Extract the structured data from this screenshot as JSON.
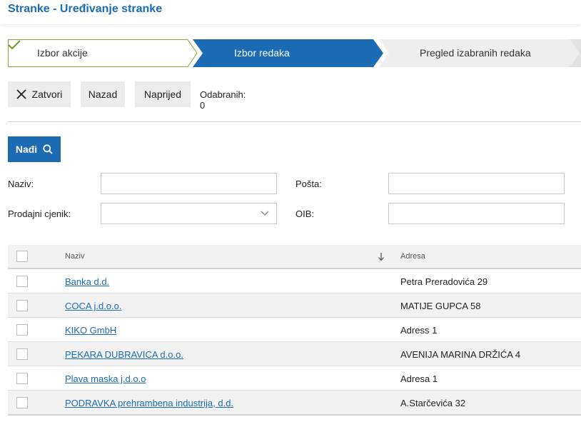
{
  "page": {
    "title": "Stranke - Uređivanje stranke"
  },
  "wizard": {
    "steps": [
      {
        "label": "Izbor akcije",
        "state": "done"
      },
      {
        "label": "Izbor redaka",
        "state": "active"
      },
      {
        "label": "Pregled izabranih redaka",
        "state": "pending"
      }
    ]
  },
  "toolbar": {
    "close_label": "Zatvori",
    "back_label": "Nazad",
    "next_label": "Naprijed",
    "selected_text": "Odabranih: 0"
  },
  "search": {
    "find_label": "Nađi",
    "fields": {
      "naziv": {
        "label": "Naziv:",
        "value": ""
      },
      "posta": {
        "label": "Pošta:",
        "value": ""
      },
      "cjenik": {
        "label": "Prodajni cjenik:",
        "value": ""
      },
      "oib": {
        "label": "OIB:",
        "value": ""
      }
    }
  },
  "table": {
    "columns": [
      "Naziv",
      "Adresa"
    ],
    "sort": {
      "column": "Naziv",
      "direction": "descending"
    },
    "rows": [
      {
        "naziv": "Banka d.d.",
        "adresa": "Petra Preradovića 29"
      },
      {
        "naziv": "COCA j.d.o.o.",
        "adresa": "MATIJE GUPCA 58"
      },
      {
        "naziv": "KIKO GmbH",
        "adresa": "Adress 1"
      },
      {
        "naziv": "PEKARA DUBRAVICA d.o.o.",
        "adresa": "AVENIJA MARINA DRŽIĆA 4"
      },
      {
        "naziv": "Plava maska j.d.o.o",
        "adresa": "Adresa 1"
      },
      {
        "naziv": "PODRAVKA prehrambena industrija, d.d.",
        "adresa": "A.Starčevića 32"
      }
    ]
  },
  "colors": {
    "accent": "#1b6cb5",
    "done_border": "#8aa838",
    "check": "#6c9a1f",
    "pending_step": "#eeeeee"
  },
  "icons": {
    "done_step": "check-icon",
    "close": "close-icon",
    "find": "search-icon",
    "select": "chevron-down-icon",
    "sort": "arrow-down-icon"
  }
}
